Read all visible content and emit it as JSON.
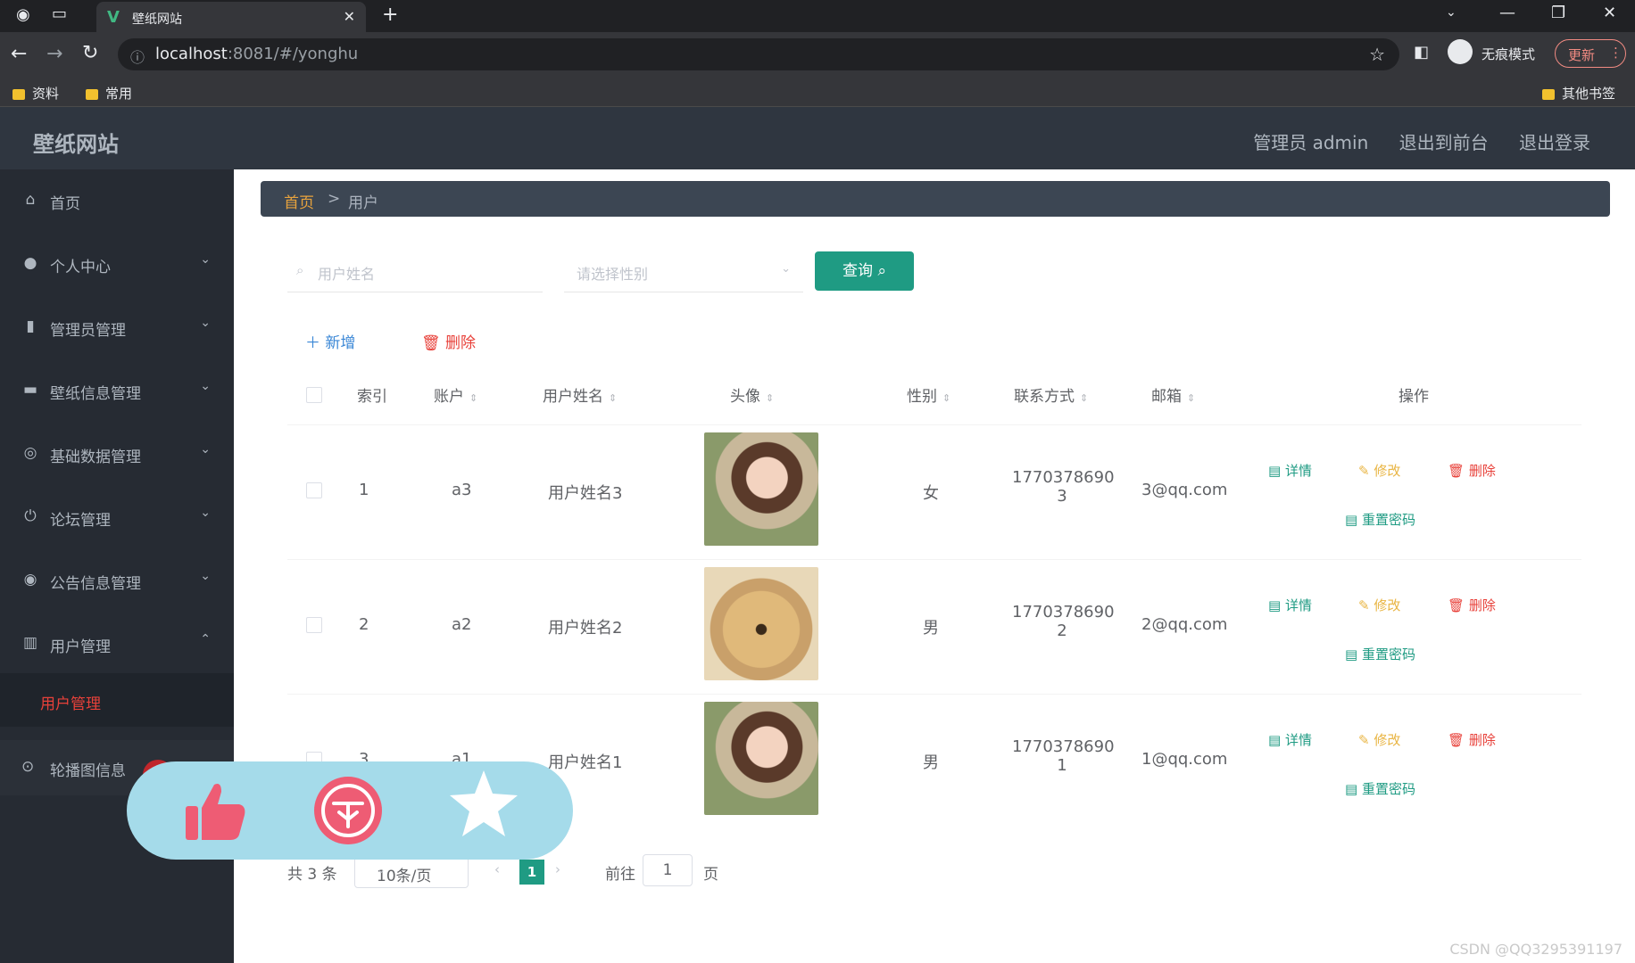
{
  "browser": {
    "tab_title": "壁纸网站",
    "url_host": "localhost",
    "url_rest": ":8081/#/yonghu",
    "incognito_label": "无痕模式",
    "update_label": "更新",
    "bookmarks": [
      "资料",
      "常用"
    ],
    "other_bookmarks": "其他书签"
  },
  "header": {
    "app_title": "壁纸网站",
    "admin_label": "管理员 admin",
    "to_front_label": "退出到前台",
    "logout_label": "退出登录"
  },
  "sidebar": {
    "items": [
      {
        "label": "首页",
        "icon": "home-icon",
        "glyph": "⌂"
      },
      {
        "label": "个人中心",
        "icon": "user-icon",
        "glyph": "👤"
      },
      {
        "label": "管理员管理",
        "icon": "bar-chart-icon",
        "glyph": "▮"
      },
      {
        "label": "壁纸信息管理",
        "icon": "ticket-icon",
        "glyph": "▬"
      },
      {
        "label": "基础数据管理",
        "icon": "compass-icon",
        "glyph": "◎"
      },
      {
        "label": "论坛管理",
        "icon": "power-icon",
        "glyph": "⏻"
      },
      {
        "label": "公告信息管理",
        "icon": "chrome-icon",
        "glyph": "◉"
      },
      {
        "label": "用户管理",
        "icon": "library-icon",
        "glyph": "▥"
      }
    ],
    "active_sub": "用户管理",
    "carousel_label": "轮播图信息"
  },
  "breadcrumb": {
    "home": "首页",
    "sep": ">",
    "current": "用户"
  },
  "search": {
    "name_placeholder": "用户姓名",
    "gender_placeholder": "请选择性别",
    "query_label": "查询"
  },
  "actions": {
    "add_label": "新增",
    "delete_label": "删除"
  },
  "table": {
    "headers": [
      "索引",
      "账户",
      "用户姓名",
      "头像",
      "性别",
      "联系方式",
      "邮箱",
      "操作"
    ],
    "rows": [
      {
        "index": "1",
        "account": "a3",
        "name": "用户姓名3",
        "gender": "女",
        "phone1": "1770378690",
        "phone2": "3",
        "email": "3@qq.com"
      },
      {
        "index": "2",
        "account": "a2",
        "name": "用户姓名2",
        "gender": "男",
        "phone1": "1770378690",
        "phone2": "2",
        "email": "2@qq.com"
      },
      {
        "index": "3",
        "account": "a1",
        "name": "用户姓名1",
        "gender": "男",
        "phone1": "1770378690",
        "phone2": "1",
        "email": "1@qq.com"
      }
    ],
    "op_detail": "详情",
    "op_edit": "修改",
    "op_delete": "删除",
    "op_reset": "重置密码"
  },
  "pager": {
    "total": "共 3 条",
    "page_size": "10条/页",
    "current_page": "1",
    "goto_label": "前往",
    "goto_value": "1",
    "page_unit": "页"
  },
  "watermark": "CSDN @QQ3295391197",
  "colors": {
    "accent": "#1f9b83",
    "danger": "#e8413a",
    "warning": "#e9b544",
    "sidebar": "#262b33"
  }
}
